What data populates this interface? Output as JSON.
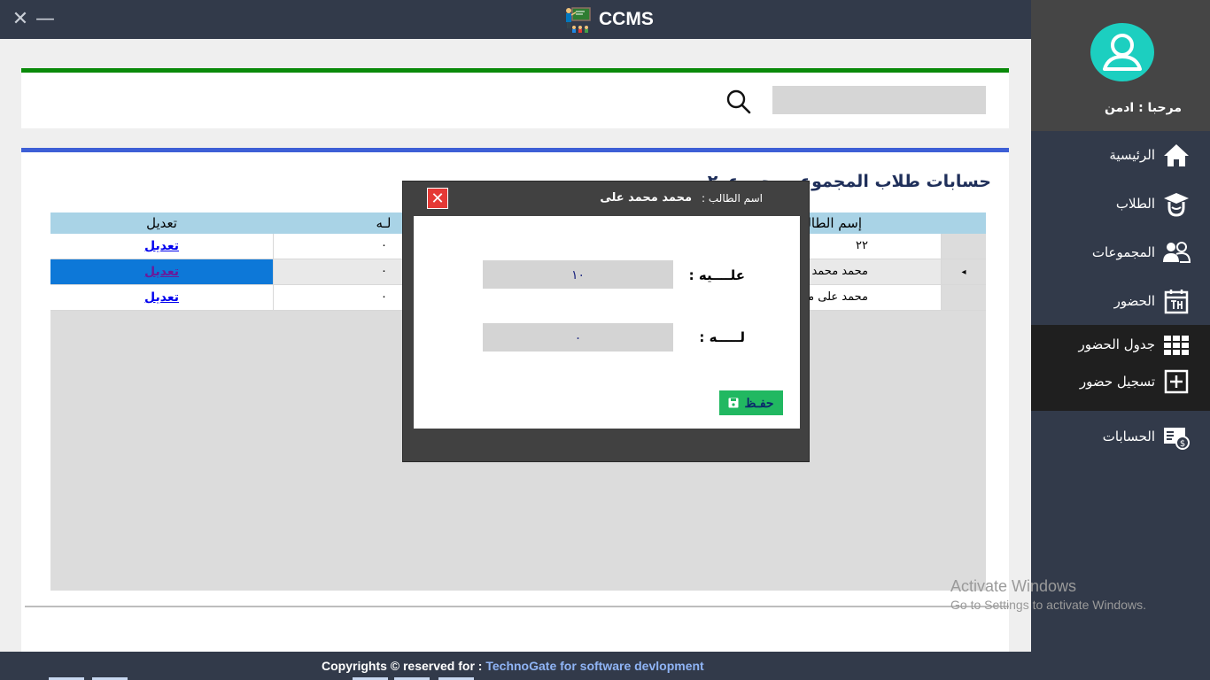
{
  "app": {
    "title": "CCMS",
    "close_glyph": "✕",
    "minimize_glyph": "—"
  },
  "search": {
    "placeholder": "",
    "value": ""
  },
  "page": {
    "title": "حسابات طلاب المجموعه  مجموعه٢"
  },
  "grid": {
    "headers": {
      "edit": "تعديل",
      "lahu": "لـه",
      "name": "إسم الطالب"
    },
    "rows": [
      {
        "name": "٢٢",
        "lahu": "٠",
        "edit": "تعديل"
      },
      {
        "name": "محمد محمد على",
        "lahu": "٠",
        "edit": "تعديل",
        "row_marker": "◂"
      },
      {
        "name": "محمد على محمد",
        "lahu": "٠",
        "edit": "تعديل"
      }
    ]
  },
  "footer": {
    "prefix": "Copyrights ©  reserved for :",
    "company": "TechnoGate for software devlopment"
  },
  "sidebar": {
    "welcome": "مرحبا :   ادمن",
    "items": [
      {
        "label": "الرئيسية",
        "icon": "home-icon"
      },
      {
        "label": "الطلاب",
        "icon": "graduate-icon"
      },
      {
        "label": "المجموعات",
        "icon": "groups-icon"
      },
      {
        "label": "الحضور",
        "icon": "calendar-icon"
      },
      {
        "label": "جدول الحضور",
        "icon": "grid-icon"
      },
      {
        "label": "تسجيل حضور",
        "icon": "plus-box-icon"
      },
      {
        "label": "الحسابات",
        "icon": "accounts-icon"
      }
    ]
  },
  "watermark": {
    "line1": "Activate Windows",
    "line2": "Go to Settings to activate Windows."
  },
  "dialog": {
    "close_glyph": "✕",
    "student_label": "اسم الطالب :",
    "student_name": "محمد محمد على",
    "alayh_label": "علــــيه :",
    "alayh_value": "١٠",
    "lahu_label": "لـــــه :",
    "lahu_value": "٠",
    "save_label": "حفـظ"
  },
  "colors": {
    "titlebar": "#323a4a",
    "search_border": "#0a8a0a",
    "content_border": "#3d5fd6",
    "grid_header": "#a9d3e6",
    "selected_cell": "#0d78d8",
    "save_button": "#21b861",
    "close_button": "#e53935",
    "avatar": "#1ccfc0"
  }
}
